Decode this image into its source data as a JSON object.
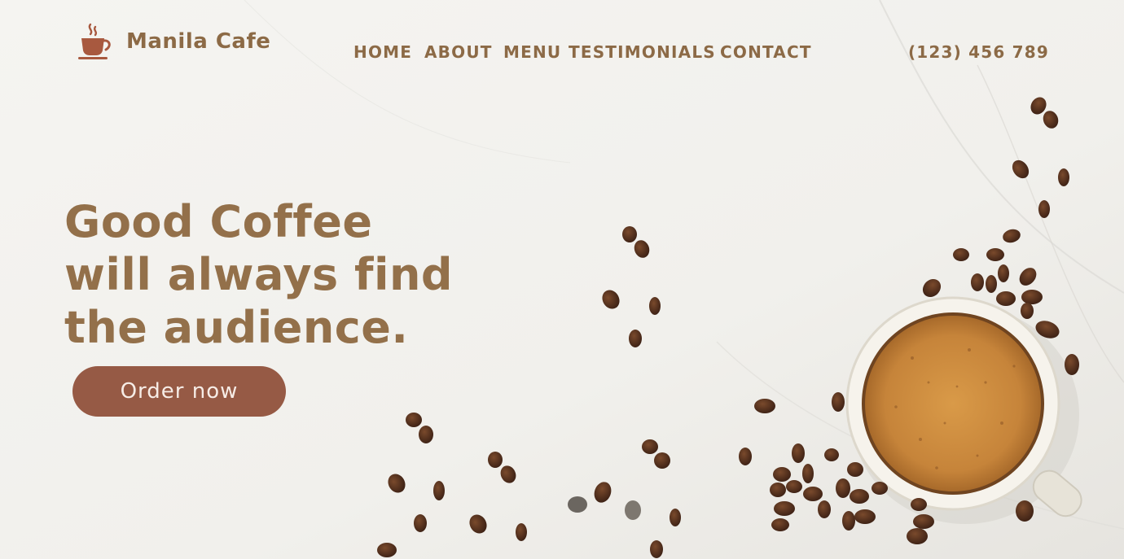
{
  "brand": {
    "name": "Manila Cafe",
    "icon": "coffee-cup-icon"
  },
  "nav": {
    "items": [
      "HOME",
      "ABOUT",
      "MENU",
      "TESTIMONIALS",
      "CONTACT"
    ]
  },
  "contact": {
    "phone": "(123) 456 789"
  },
  "hero": {
    "lines": [
      "Good Coffee",
      "will always find",
      "the audience."
    ],
    "cta_label": "Order now"
  },
  "colors": {
    "brand_brown": "#8c6a46",
    "heading": "#93704a",
    "button": "#965a45",
    "background": "#f3f2ef",
    "espresso": "#c98a3c",
    "bean": "#4a2a1a"
  }
}
